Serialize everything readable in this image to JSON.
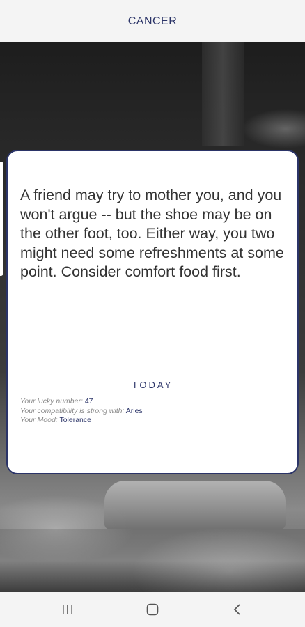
{
  "header": {
    "title": "CANCER"
  },
  "card": {
    "horoscope": "A friend may try to mother you, and you won't argue -- but the shoe may be on the other foot, too. Either way, you two might need some refreshments at some point. Consider comfort food first.",
    "section_label": "TODAY",
    "lucky_number_label": "Your lucky number:",
    "lucky_number_value": "47",
    "compatibility_label": "Your compatibility is strong with:",
    "compatibility_value": "Aries",
    "mood_label": "Your Mood:",
    "mood_value": "Tolerance"
  },
  "navbar": {
    "recents_icon": "recent-apps-icon",
    "home_icon": "home-icon",
    "back_icon": "back-icon"
  },
  "colors": {
    "accent": "#2b3468",
    "text": "#333333",
    "muted": "#8a8a8a"
  }
}
